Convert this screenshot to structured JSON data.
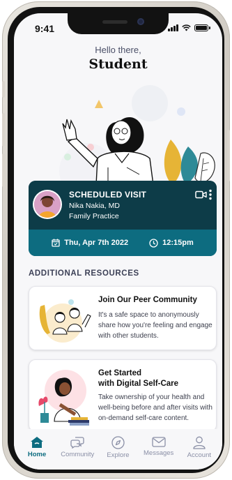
{
  "status_bar": {
    "time": "9:41"
  },
  "header": {
    "greeting": "Hello there,",
    "name": "Student"
  },
  "visit": {
    "title": "SCHEDULED VISIT",
    "doctor": "Nika Nakia, MD",
    "specialty": "Family Practice",
    "date": "Thu, Apr 7th 2022",
    "time": "12:15pm",
    "icons": {
      "video": "video-camera-icon",
      "more": "more-vertical-icon",
      "calendar": "calendar-icon",
      "clock": "clock-icon"
    }
  },
  "resources": {
    "section_title": "ADDITIONAL RESOURCES",
    "cards": [
      {
        "title": "Join Our Peer Community",
        "description": "It's a safe space to anonymously share how you're feeling and engage with other students."
      },
      {
        "title_line1": "Get Started",
        "title_line2": "with Digital Self-Care",
        "description": "Take ownership of your health and well-being before and after visits with on-demand self-care content."
      }
    ]
  },
  "tabbar": {
    "tabs": [
      {
        "label": "Home",
        "icon": "home-icon",
        "active": true
      },
      {
        "label": "Community",
        "icon": "chat-bubbles-icon",
        "active": false
      },
      {
        "label": "Explore",
        "icon": "compass-icon",
        "active": false
      },
      {
        "label": "Messages",
        "icon": "mail-icon",
        "active": false
      },
      {
        "label": "Account",
        "icon": "user-icon",
        "active": false
      }
    ]
  },
  "colors": {
    "primary": "#0d6c80",
    "card_dark": "#0d3c48",
    "accent_yellow": "#e6b436",
    "accent_teal": "#2e8a97"
  }
}
